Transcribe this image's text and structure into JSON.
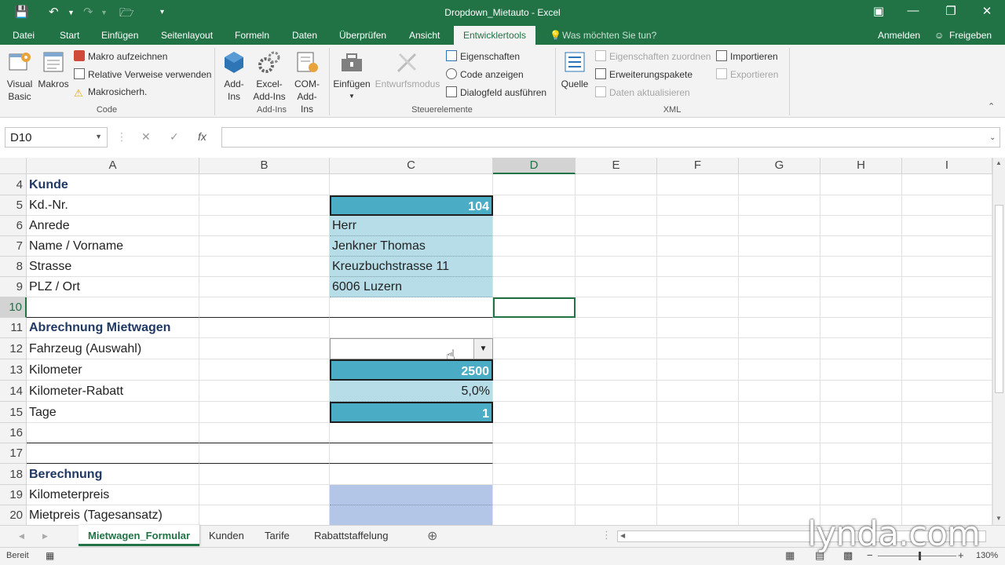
{
  "window": {
    "title": "Dropdown_Mietauto - Excel"
  },
  "tabs": [
    {
      "label": "Datei"
    },
    {
      "label": "Start"
    },
    {
      "label": "Einfügen"
    },
    {
      "label": "Seitenlayout"
    },
    {
      "label": "Formeln"
    },
    {
      "label": "Daten"
    },
    {
      "label": "Überprüfen"
    },
    {
      "label": "Ansicht"
    },
    {
      "label": "Entwicklertools"
    }
  ],
  "tell_me": "Was möchten Sie tun?",
  "account": {
    "user": "Anmelden",
    "share": "Freigeben"
  },
  "ribbon": {
    "code": {
      "label": "Code",
      "visual_basic": "Visual Basic",
      "macros": "Makros",
      "record": "Makro aufzeichnen",
      "relative": "Relative Verweise verwenden",
      "security": "Makrosicherh."
    },
    "addins": {
      "label": "Add-Ins",
      "addins": "Add-Ins",
      "excel_addins": "Excel-Add-Ins",
      "com_addins": "COM-Add-Ins"
    },
    "controls": {
      "label": "Steuerelemente",
      "insert": "Einfügen",
      "design_mode": "Entwurfsmodus",
      "properties": "Eigenschaften",
      "view_code": "Code anzeigen",
      "run_dialog": "Dialogfeld ausführen"
    },
    "xml": {
      "label": "XML",
      "source": "Quelle",
      "map_properties": "Eigenschaften zuordnen",
      "expansion": "Erweiterungspakete",
      "refresh": "Daten aktualisieren",
      "import": "Importieren",
      "export": "Exportieren"
    }
  },
  "formula_bar": {
    "name_box": "D10",
    "fx": "fx",
    "value": ""
  },
  "columns": [
    "A",
    "B",
    "C",
    "D",
    "E",
    "F",
    "G",
    "H",
    "I"
  ],
  "rows": [
    {
      "n": "4",
      "a": "Kunde",
      "c": ""
    },
    {
      "n": "5",
      "a": "Kd.-Nr.",
      "c": "104"
    },
    {
      "n": "6",
      "a": "Anrede",
      "c": "Herr"
    },
    {
      "n": "7",
      "a": "Name / Vorname",
      "c": "Jenkner Thomas"
    },
    {
      "n": "8",
      "a": "Strasse",
      "c": "Kreuzbuchstrasse 11"
    },
    {
      "n": "9",
      "a": "PLZ / Ort",
      "c": "6006 Luzern"
    },
    {
      "n": "10",
      "a": "",
      "c": ""
    },
    {
      "n": "11",
      "a": "Abrechnung Mietwagen",
      "c": ""
    },
    {
      "n": "12",
      "a": "Fahrzeug (Auswahl)",
      "c": ""
    },
    {
      "n": "13",
      "a": "Kilometer",
      "c": "2500"
    },
    {
      "n": "14",
      "a": "Kilometer-Rabatt",
      "c": "5,0%"
    },
    {
      "n": "15",
      "a": "Tage",
      "c": "1"
    },
    {
      "n": "16",
      "a": "",
      "c": ""
    },
    {
      "n": "17",
      "a": "",
      "c": ""
    },
    {
      "n": "18",
      "a": "Berechnung",
      "c": ""
    },
    {
      "n": "19",
      "a": "Kilometerpreis",
      "c": ""
    },
    {
      "n": "20",
      "a": "Mietpreis (Tagesansatz)",
      "c": ""
    }
  ],
  "sheets": [
    {
      "label": "Mietwagen_Formular"
    },
    {
      "label": "Kunden"
    },
    {
      "label": "Tarife"
    },
    {
      "label": "Rabattstaffelung"
    }
  ],
  "status": {
    "ready": "Bereit",
    "zoom": "130%"
  },
  "watermark": "lynda.com",
  "colors": {
    "accent": "#217346",
    "cell_dark": "#4bacc6",
    "cell_light": "#b7dee8",
    "cell_lavender": "#b4c6e7",
    "heading": "#1f3864"
  }
}
